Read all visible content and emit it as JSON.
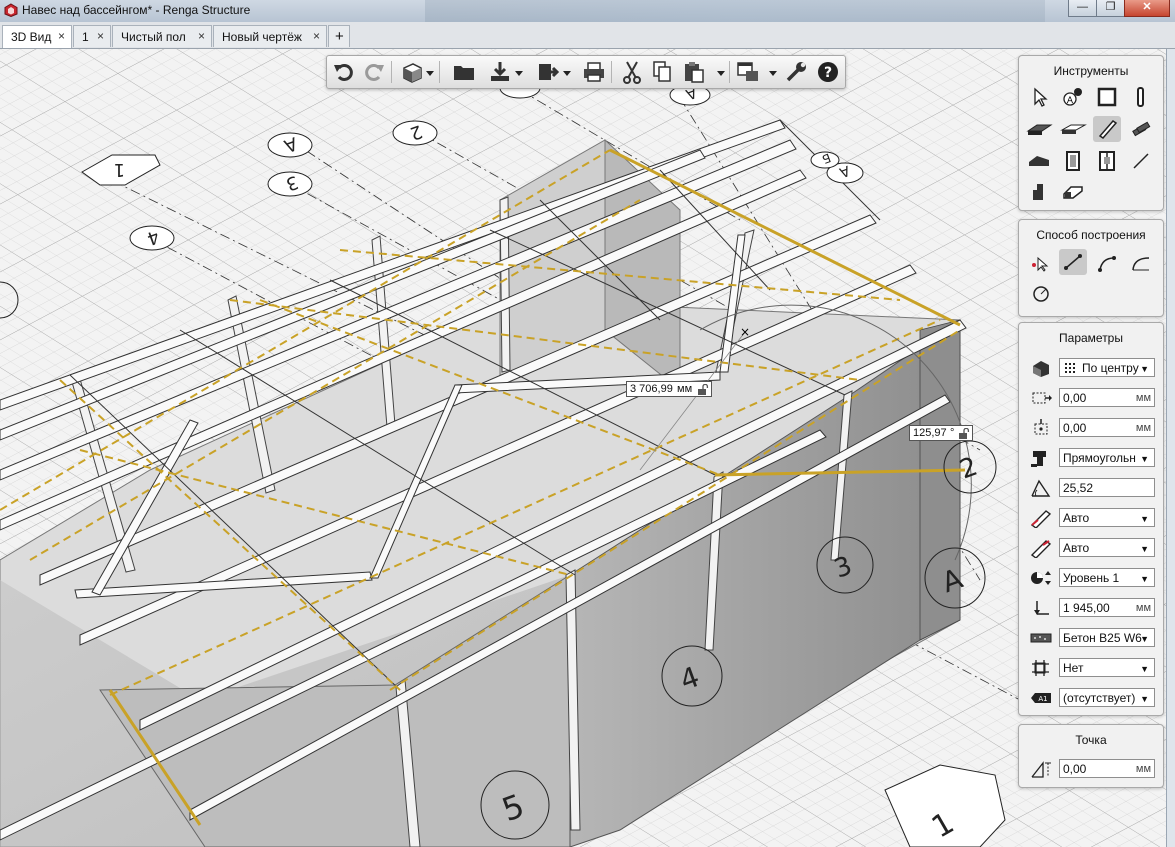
{
  "window": {
    "title": "Навес над бассейнгом* - Renga Structure"
  },
  "tabs": [
    {
      "label": "3D Вид",
      "active": true
    },
    {
      "label": "1",
      "active": false
    },
    {
      "label": "Чистый пол",
      "active": false
    },
    {
      "label": "Новый чертёж",
      "active": false
    }
  ],
  "tab_add_label": "+",
  "tab_close_glyph": "×",
  "toolbar": {
    "buttons": [
      "undo-icon",
      "redo-icon",
      "view-cube-icon",
      "folder-icon",
      "import-icon",
      "export-icon",
      "print-icon",
      "cut-icon",
      "copy-icon",
      "paste-icon",
      "layers-icon",
      "settings-wrench-icon",
      "help-icon"
    ]
  },
  "tools_panel": {
    "title": "Инструменты",
    "tools": [
      "select-icon",
      "axis-icon",
      "wall-icon",
      "column-icon",
      "slab-icon",
      "floor-icon",
      "beam-icon",
      "rebar-icon",
      "roof-icon",
      "door-icon",
      "window-icon",
      "line-icon",
      "stair-icon",
      "ramp-icon"
    ],
    "selected": "beam-icon"
  },
  "build_mode_panel": {
    "title": "Способ построения",
    "modes": [
      "point-mode-icon",
      "segment-mode-icon",
      "arc-mode-icon",
      "curve-mode-icon",
      "circle-mode-icon"
    ],
    "selected": "segment-mode-icon"
  },
  "params_panel": {
    "title": "Параметры",
    "rows": [
      {
        "icon": "alignment-icon",
        "type": "select",
        "value": "По центру",
        "value_icon": "center-grid-icon"
      },
      {
        "icon": "offset-x-icon",
        "type": "input",
        "value": "0,00",
        "unit": "мм"
      },
      {
        "icon": "offset-y-icon",
        "type": "input",
        "value": "0,00",
        "unit": "мм"
      },
      {
        "icon": "profile-icon",
        "type": "select",
        "value": "Прямоугольн"
      },
      {
        "icon": "angle-icon",
        "type": "input",
        "value": "25,52",
        "unit": ""
      },
      {
        "icon": "start-cut-icon",
        "type": "select",
        "value": "Авто"
      },
      {
        "icon": "end-cut-icon",
        "type": "select",
        "value": "Авто"
      },
      {
        "icon": "level-icon",
        "type": "select",
        "value": "Уровень 1"
      },
      {
        "icon": "elevation-icon",
        "type": "input",
        "value": "1 945,00",
        "unit": "мм"
      },
      {
        "icon": "material-icon",
        "type": "select",
        "value": "Бетон B25 W6"
      },
      {
        "icon": "rebar-grid-icon",
        "type": "select",
        "value": "Нет"
      },
      {
        "icon": "mark-icon",
        "type": "select",
        "value": "(отсутствует)"
      }
    ]
  },
  "point_panel": {
    "title": "Точка",
    "row": {
      "icon": "point-elevation-icon",
      "value": "0,00",
      "unit": "мм"
    }
  },
  "viewport": {
    "length_readout": {
      "value": "3 706,99",
      "unit": "мм"
    },
    "angle_readout": {
      "value": "125,97",
      "unit": "°"
    },
    "grid_labels": [
      "1",
      "2",
      "3",
      "4",
      "5",
      "A",
      "A",
      "A",
      "2",
      "3",
      "4",
      "1",
      "Б",
      "A"
    ]
  },
  "colors": {
    "selection_yellow": "#c9a227",
    "title_bar": "#c3cedb",
    "panel_bg": "#f1f1f1",
    "selected_tool_bg": "#c9c9c9"
  }
}
